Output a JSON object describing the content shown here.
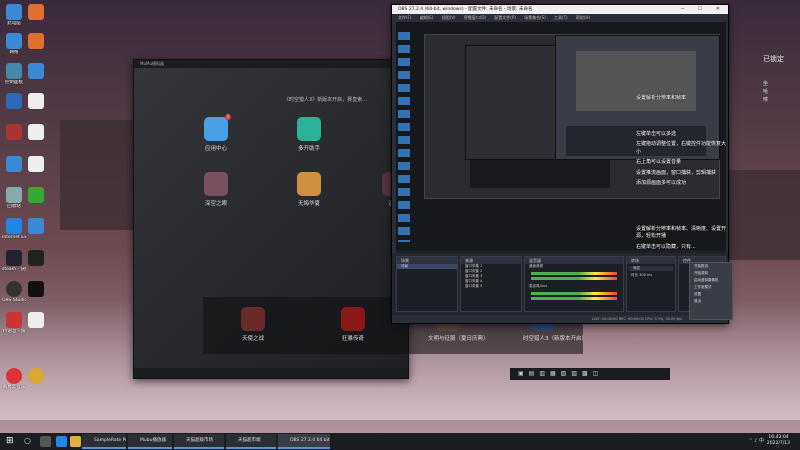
{
  "desktop": {
    "icons": [
      {
        "label": "此电脑",
        "color": "#3a8ad6"
      },
      {
        "label": "网络",
        "color": "#3a8ad6"
      },
      {
        "label": "控制面板",
        "color": "#48a"
      },
      {
        "label": "回收站",
        "color": "#8aa"
      },
      {
        "label": "Internet Explorer",
        "color": "#1e88e5"
      },
      {
        "label": "steam - 快捷方式",
        "color": "#223"
      },
      {
        "label": "OBS Studio",
        "color": "#333"
      },
      {
        "label": "YY语音 - 快捷方式",
        "color": "#c33"
      },
      {
        "label": "网易云音乐",
        "color": "#d33"
      }
    ]
  },
  "emulator": {
    "title": "MuMu模拟器",
    "search_text": "《时空猎人3》新版本开启，赛皇索...",
    "apps": [
      {
        "label": "应用中心",
        "badge": "1",
        "color": "#4aa0e6"
      },
      {
        "label": "多开助手",
        "color": "#2bb39a"
      },
      {
        "label": "深空之眼",
        "color": "#7a5060"
      },
      {
        "label": "无悔华夏",
        "color": "#d09040"
      },
      {
        "label": "决战",
        "color": "#5a3040"
      }
    ],
    "dock": [
      {
        "label": "天使之战",
        "color": "#6a2a2a"
      },
      {
        "label": "狂暴传奇",
        "color": "#8a1818"
      },
      {
        "label": "文明与征服（夏日庆典）",
        "color": "#5a4a3a"
      },
      {
        "label": "时空猎人3（新版本开启）",
        "color": "#2a4a7a"
      }
    ]
  },
  "obs": {
    "title": "OBS 27.2.4 (64-bit, windows) - 配置文件: 未命名 - 场景: 未命名",
    "menu": [
      "文件(F)",
      "编辑(E)",
      "视图(V)",
      "停靠窗口(D)",
      "配置文件(P)",
      "场景集合(S)",
      "工具(T)",
      "帮助(H)"
    ],
    "panels": {
      "scenes": "场景",
      "sources": "来源",
      "mixer": "混音器",
      "transitions": "转场",
      "controls": "控件"
    },
    "scene_items": [
      "场景"
    ],
    "source_items": [
      "窗口采集 1",
      "窗口采集 2",
      "窗口采集 3",
      "窗口采集 4",
      "窗口采集 5"
    ],
    "mixer_tracks": [
      "桌面音频",
      "麦克风/Aux"
    ],
    "transition": "渐变",
    "duration_label": "时长",
    "duration_value": "300 ms",
    "status": "LIVE: 00:00:00   REC: 00:00:00   CPU: 3.3%, 30.00 fps",
    "no_source_selected": "未选择源",
    "context_menu": [
      "开始推流",
      "开始录制",
      "启动虚拟摄像机",
      "工作室模式",
      "设置",
      "退出"
    ]
  },
  "notes": {
    "lines": [
      "设置解析分辨率和帧率",
      "左键单击可以多选",
      "左键拖动调整位置，右键控件功能恢复大小",
      "右上角可以设置音量",
      "设置推流画面，窗口捕获，剪辑捕获",
      "添加源画面多可以成功",
      "设置解析分辨率和帧率、清晰度、设置开源，轻松开播",
      "右键单击可以隐藏，只有..."
    ]
  },
  "right_side": {
    "lock_label": "已锁定",
    "chars": [
      "坐",
      "哈",
      "嗦"
    ]
  },
  "taskbar": {
    "buttons": [
      {
        "label": "SampleRate Per 8..."
      },
      {
        "label": "Mubu播放器"
      },
      {
        "label": "天猫超级市场"
      },
      {
        "label": "天猫超市端"
      },
      {
        "label": "OBS 27.2.4 64 bit..."
      }
    ],
    "time": "16:43:04",
    "date": "2022/7/13"
  }
}
